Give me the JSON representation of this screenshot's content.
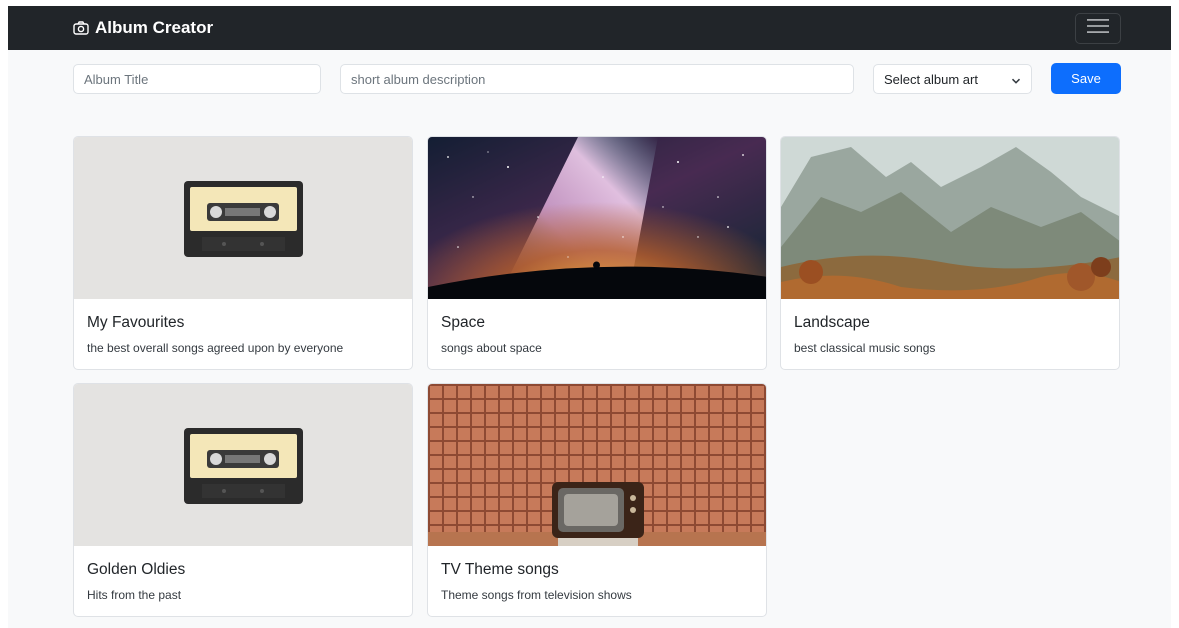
{
  "navbar": {
    "brand": "Album Creator",
    "brand_icon": "camera-icon",
    "toggler_icon": "hamburger-menu-icon"
  },
  "form": {
    "title_placeholder": "Album Title",
    "description_placeholder": "short album description",
    "art_select_value": "Select album art",
    "save_label": "Save"
  },
  "colors": {
    "navbar": "#212529",
    "primary": "#0d6efd",
    "page_background": "#f8f9fa"
  },
  "albums": [
    {
      "title": "My Favourites",
      "description": "the best overall songs agreed upon by everyone",
      "art": "cassette-tape-image"
    },
    {
      "title": "Space",
      "description": "songs about space",
      "art": "milky-way-night-sky-image"
    },
    {
      "title": "Landscape",
      "description": "best classical music songs",
      "art": "mountain-landscape-painting-image"
    },
    {
      "title": "Golden Oldies",
      "description": "Hits from the past",
      "art": "cassette-tape-image"
    },
    {
      "title": "TV Theme songs",
      "description": "Theme songs from television shows",
      "art": "retro-tv-on-plaid-wall-image"
    }
  ]
}
